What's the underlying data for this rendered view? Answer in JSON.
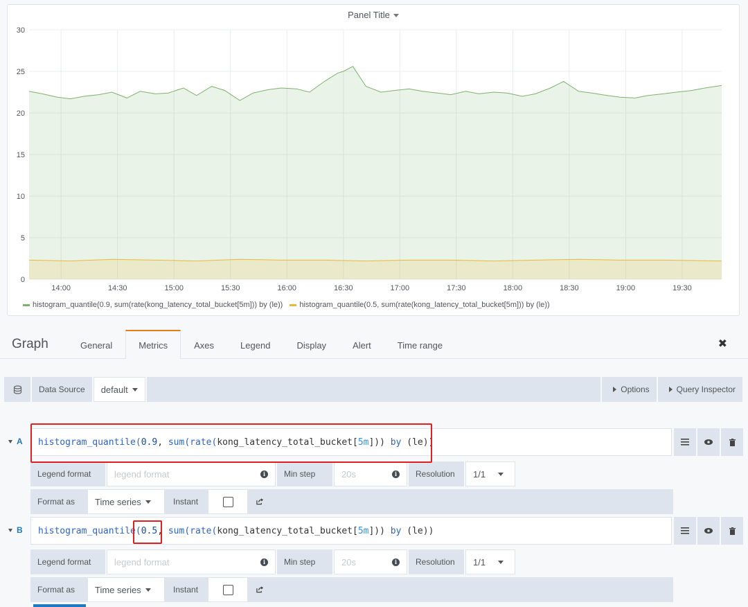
{
  "panel": {
    "title": "Panel Title"
  },
  "chart_data": {
    "type": "area",
    "y_ticks": [
      0,
      5,
      10,
      15,
      20,
      25,
      30
    ],
    "ylim": [
      0,
      30
    ],
    "x_tick_labels": [
      "14:00",
      "14:30",
      "15:00",
      "15:30",
      "16:00",
      "16:30",
      "17:00",
      "17:30",
      "18:00",
      "18:30",
      "19:00",
      "19:30"
    ],
    "x_start": "13:43",
    "x_end": "19:51",
    "grid": true,
    "legend_position": "bottom-left",
    "series": [
      {
        "name": "histogram_quantile(0.9, sum(rate(kong_latency_total_bucket[5m])) by (le))",
        "color": "#7eb26d",
        "x": [
          "13:43",
          "13:50",
          "13:58",
          "14:05",
          "14:12",
          "14:20",
          "14:27",
          "14:35",
          "14:42",
          "14:50",
          "14:57",
          "15:05",
          "15:12",
          "15:20",
          "15:27",
          "15:35",
          "15:42",
          "15:50",
          "15:57",
          "16:05",
          "16:12",
          "16:20",
          "16:27",
          "16:30",
          "16:35",
          "16:42",
          "16:50",
          "16:57",
          "17:05",
          "17:12",
          "17:20",
          "17:27",
          "17:35",
          "17:42",
          "17:50",
          "17:57",
          "18:05",
          "18:12",
          "18:20",
          "18:27",
          "18:35",
          "18:42",
          "18:50",
          "18:57",
          "19:05",
          "19:12",
          "19:20",
          "19:27",
          "19:35",
          "19:42",
          "19:51"
        ],
        "values": [
          22.6,
          22.3,
          21.9,
          21.7,
          22.0,
          22.2,
          22.5,
          21.8,
          22.6,
          22.3,
          22.4,
          23.0,
          22.1,
          23.2,
          22.7,
          21.5,
          22.4,
          22.8,
          23.0,
          22.9,
          22.5,
          23.8,
          24.8,
          25.0,
          25.6,
          23.2,
          22.5,
          22.7,
          22.9,
          22.6,
          22.4,
          22.2,
          22.6,
          22.3,
          22.5,
          22.4,
          22.0,
          22.3,
          23.0,
          23.8,
          22.6,
          22.4,
          22.1,
          21.9,
          21.8,
          22.1,
          22.3,
          22.5,
          22.7,
          23.0,
          23.3
        ]
      },
      {
        "name": "histogram_quantile(0.5, sum(rate(kong_latency_total_bucket[5m])) by (le))",
        "color": "#eab839",
        "x": [
          "13:43",
          "14:05",
          "14:27",
          "14:50",
          "15:12",
          "15:35",
          "15:57",
          "16:20",
          "16:42",
          "17:05",
          "17:27",
          "17:50",
          "18:12",
          "18:35",
          "18:57",
          "19:20",
          "19:51"
        ],
        "values": [
          2.3,
          2.2,
          2.4,
          2.3,
          2.2,
          2.4,
          2.3,
          2.3,
          2.2,
          2.3,
          2.3,
          2.2,
          2.3,
          2.4,
          2.3,
          2.3,
          2.2
        ]
      }
    ]
  },
  "editor": {
    "title": "Graph",
    "tabs": [
      "General",
      "Metrics",
      "Axes",
      "Legend",
      "Display",
      "Alert",
      "Time range"
    ],
    "active_tab": "Metrics",
    "close_glyph": "✖"
  },
  "datasource": {
    "label": "Data Source",
    "value": "default",
    "options_label": "Options",
    "inspector_label": "Query Inspector"
  },
  "queries": [
    {
      "letter": "A",
      "q_fn": "histogram_quantile(",
      "q_num": "0.9",
      "q_comma": ", ",
      "q_sum": "sum(rate(",
      "q_metric": "kong_latency_total_bucket",
      "q_open": "[",
      "q_range": "5m",
      "q_close": "])) ",
      "q_by": "by",
      "q_tail": " (le))",
      "legend_label": "Legend format",
      "legend_placeholder": "legend format",
      "minstep_label": "Min step",
      "minstep_placeholder": "20s",
      "resolution_label": "Resolution",
      "resolution_value": "1/1",
      "format_label": "Format as",
      "format_value": "Time series",
      "instant_label": "Instant"
    },
    {
      "letter": "B",
      "q_fn": "histogram_quantile(",
      "q_num": "0.5",
      "q_comma": ", ",
      "q_sum": "sum(rate(",
      "q_metric": "kong_latency_total_bucket",
      "q_open": "[",
      "q_range": "5m",
      "q_close": "])) ",
      "q_by": "by",
      "q_tail": " (le))",
      "legend_label": "Legend format",
      "legend_placeholder": "legend format",
      "minstep_label": "Min step",
      "minstep_placeholder": "20s",
      "resolution_label": "Resolution",
      "resolution_value": "1/1",
      "format_label": "Format as",
      "format_value": "Time series",
      "instant_label": "Instant"
    }
  ]
}
